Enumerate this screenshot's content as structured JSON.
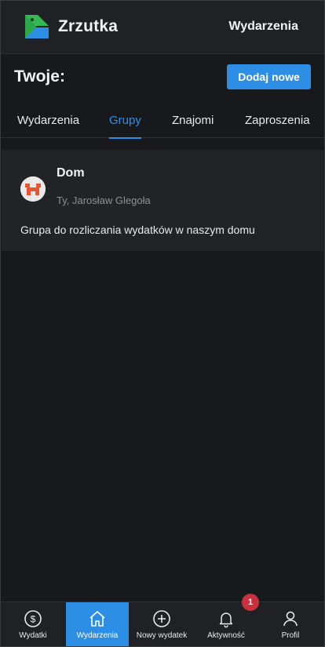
{
  "header": {
    "brand": "Zrzutka",
    "nav_link": "Wydarzenia"
  },
  "page": {
    "title": "Twoje:",
    "add_button": "Dodaj nowe"
  },
  "tabs": [
    {
      "label": "Wydarzenia",
      "active": false
    },
    {
      "label": "Grupy",
      "active": true
    },
    {
      "label": "Znajomi",
      "active": false
    },
    {
      "label": "Zaproszenia",
      "active": false
    }
  ],
  "groups": [
    {
      "name": "Dom",
      "members": "Ty, Jarosław Glegoła",
      "description": "Grupa do rozliczania wydatków w naszym domu",
      "avatar_icon": "group-avatar-icon"
    }
  ],
  "bottom_nav": [
    {
      "label": "Wydatki",
      "icon": "dollar-circle-icon",
      "active": false
    },
    {
      "label": "Wydarzenia",
      "icon": "home-icon",
      "active": true
    },
    {
      "label": "Nowy wydatek",
      "icon": "plus-circle-icon",
      "active": false
    },
    {
      "label": "Aktywność",
      "icon": "bell-icon",
      "active": false,
      "badge": "1"
    },
    {
      "label": "Profil",
      "icon": "user-icon",
      "active": false
    }
  ],
  "colors": {
    "background": "#18191c",
    "surface": "#202124",
    "accent": "#2d8ee6",
    "badge": "#c8313e"
  }
}
